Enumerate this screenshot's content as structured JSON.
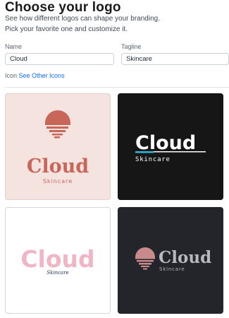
{
  "header": {
    "title": "Choose your logo",
    "subtitle_line1": "See how different logos can shape your branding.",
    "subtitle_line2": "Pick your favorite one and customize it."
  },
  "form": {
    "name_label": "Name",
    "name_value": "Cloud",
    "tagline_label": "Tagline",
    "tagline_value": "Skincare",
    "icon_label": "Icon",
    "icon_link": "See Other Icons"
  },
  "logos": [
    {
      "name": "Cloud",
      "tagline": "Skincare",
      "background": "#f4e3df",
      "color": "#c8665a",
      "icon": "sunset-cloud-icon"
    },
    {
      "name": "Cloud",
      "tagline": "Skincare",
      "background": "#161616",
      "color": "#ffffff",
      "accent": "#2fb8d8"
    },
    {
      "name": "Cloud",
      "tagline": "Skincare",
      "background": "#ffffff",
      "color": "#f0b6c6",
      "tagline_color": "#1f2d55"
    },
    {
      "name": "Cloud",
      "tagline": "Skincare",
      "background": "#24242b",
      "color": "#b7babd",
      "icon_color": "#c98a8c",
      "icon": "sunset-cloud-icon"
    }
  ]
}
